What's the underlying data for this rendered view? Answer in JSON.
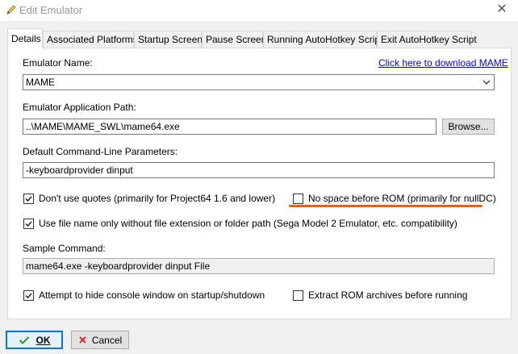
{
  "window": {
    "title": "Edit Emulator",
    "close_glyph": "✕",
    "title_icon": "pencil-icon"
  },
  "tabs": [
    {
      "label": "Details",
      "active": true
    },
    {
      "label": "Associated Platforms",
      "active": false
    },
    {
      "label": "Startup Screen",
      "active": false
    },
    {
      "label": "Pause Screen",
      "active": false
    },
    {
      "label": "Running AutoHotkey Script",
      "active": false
    },
    {
      "label": "Exit AutoHotkey Script",
      "active": false
    }
  ],
  "details": {
    "emulator_name_label": "Emulator Name:",
    "download_link": "Click here to download MAME",
    "emulator_name_value": "MAME",
    "app_path_label": "Emulator Application Path:",
    "app_path_value": "..\\MAME\\MAME_SWL\\mame64.exe",
    "browse_label": "Browse...",
    "params_label": "Default Command-Line Parameters:",
    "params_value": "-keyboardprovider dinput",
    "dont_use_quotes": {
      "label": "Don't use quotes (primarily for Project64 1.6 and lower)",
      "checked": true
    },
    "no_space_before_rom": {
      "label": "No space before ROM (primarily for nullDC)",
      "checked": false
    },
    "file_name_only": {
      "label": "Use file name only without file extension or folder path (Sega Model 2 Emulator, etc. compatibility)",
      "checked": true
    },
    "sample_command_label": "Sample Command:",
    "sample_command_value": "mame64.exe -keyboardprovider dinput File",
    "hide_console": {
      "label": "Attempt to hide console window on startup/shutdown",
      "checked": true
    },
    "extract_rom": {
      "label": "Extract ROM archives before running",
      "checked": false
    }
  },
  "footer": {
    "ok_label": "OK",
    "cancel_label": "Cancel"
  },
  "colors": {
    "accent": "#0078d7",
    "annotation": "#e8620e",
    "link": "#0000ee",
    "ok_check": "#2ca02c",
    "cancel_x": "#d32f2f"
  }
}
